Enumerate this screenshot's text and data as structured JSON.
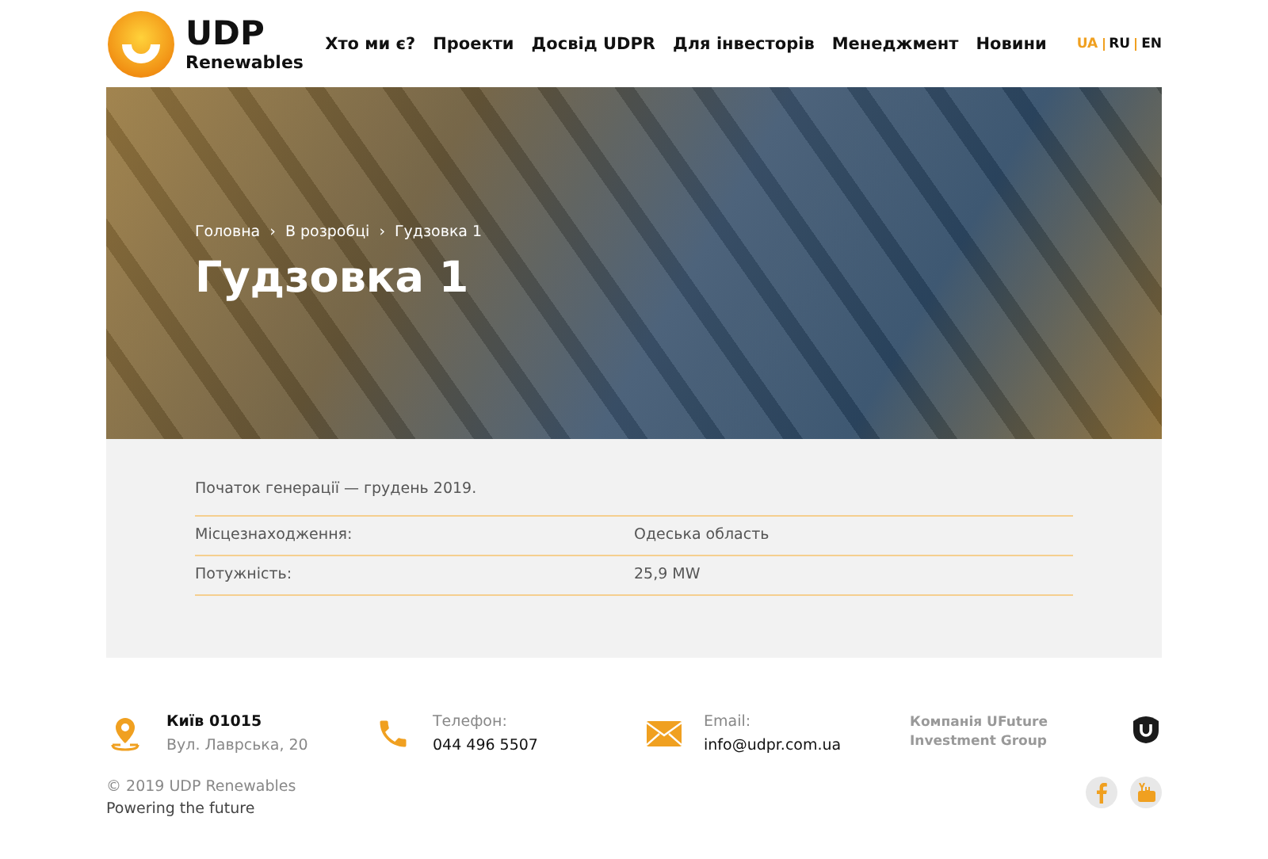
{
  "header": {
    "logo": {
      "title": "UDP",
      "subtitle": "Renewables"
    },
    "nav": [
      "Хто ми є?",
      "Проекти",
      "Досвід UDPR",
      "Для інвесторів",
      "Менеджмент",
      "Новини"
    ],
    "languages": [
      {
        "label": "UA",
        "selected": true
      },
      {
        "label": "RU",
        "selected": false
      },
      {
        "label": "EN",
        "selected": false
      }
    ]
  },
  "hero": {
    "breadcrumbs": [
      "Головна",
      "В розробці",
      "Гудзовка 1"
    ],
    "separator": "›",
    "title": "Гудзовка 1"
  },
  "details": {
    "intro": "Початок генерації — грудень 2019.",
    "rows": [
      {
        "label": "Місцезнаходження:",
        "value": "Одеська область"
      },
      {
        "label": "Потужність:",
        "value": "25,9 MW"
      }
    ]
  },
  "footer": {
    "address": {
      "city": "Київ 01015",
      "street": "Вул. Лаврська, 20"
    },
    "phone": {
      "label": "Телефон:",
      "value": "044 496 5507"
    },
    "email": {
      "label": "Email:",
      "value": "info@udpr.com.ua"
    },
    "company": [
      "Компанія UFuture",
      "Investment Group"
    ],
    "copyright": "© 2019 UDP Renewables",
    "tagline": "Powering the future"
  }
}
